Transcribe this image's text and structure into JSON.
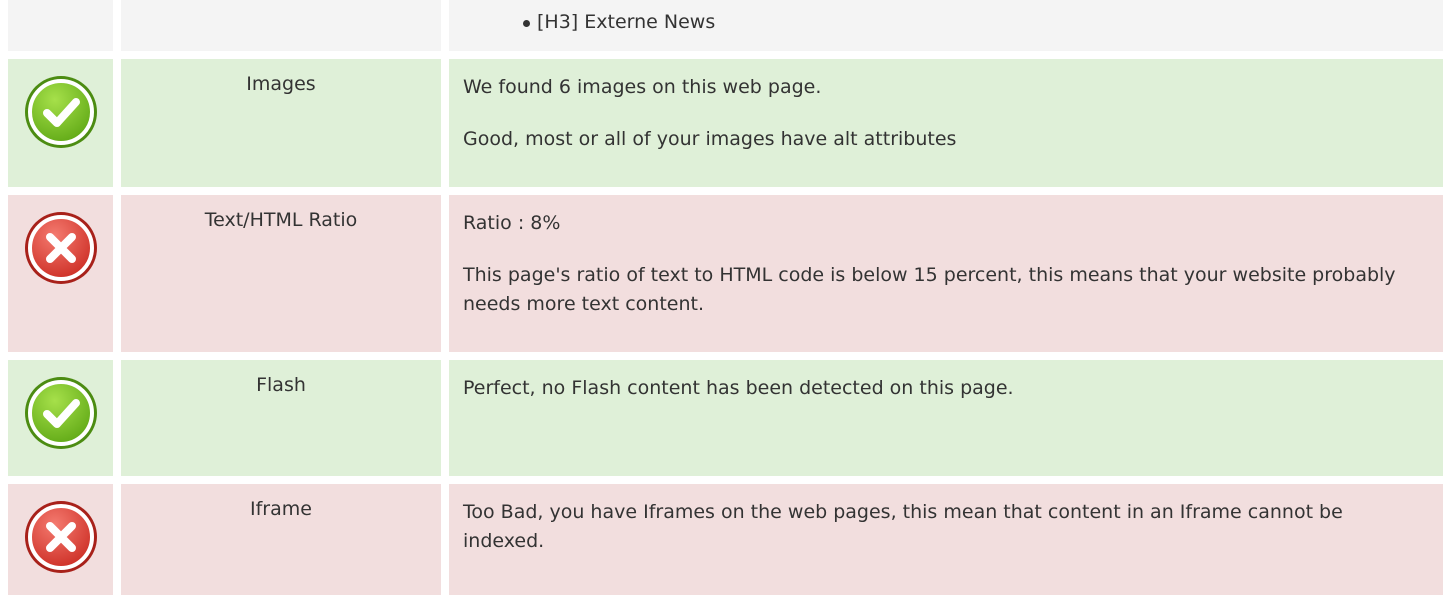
{
  "top_row": {
    "items": [
      "[H3] Externe News"
    ]
  },
  "rows": [
    {
      "status": "pass",
      "label": "Images",
      "lines": [
        "We found 6 images on this web page.",
        "Good, most or all of your images have alt attributes"
      ]
    },
    {
      "status": "fail",
      "label": "Text/HTML Ratio",
      "lines": [
        "Ratio : 8%",
        "This page's ratio of text to HTML code is below 15 percent, this means that your website probably needs more text content."
      ]
    },
    {
      "status": "pass",
      "label": "Flash",
      "lines": [
        "Perfect, no Flash content has been detected on this page."
      ]
    },
    {
      "status": "fail",
      "label": "Iframe",
      "lines": [
        "Too Bad, you have Iframes on the web pages, this mean that content in an Iframe cannot be indexed."
      ]
    }
  ],
  "icons": {
    "pass": "check-circle-icon",
    "fail": "x-circle-icon"
  },
  "colors": {
    "pass_bg": "#dff0d8",
    "fail_bg": "#f2dede",
    "neutral_bg": "#f4f4f4",
    "pass_icon": "#7cc226",
    "fail_icon": "#e0413a"
  }
}
